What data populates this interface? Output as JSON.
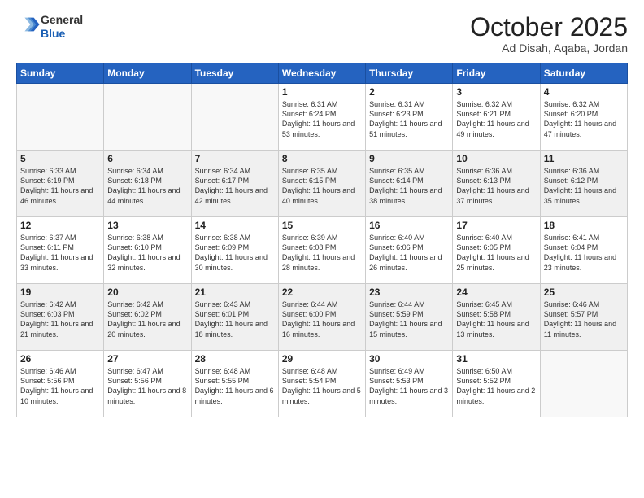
{
  "header": {
    "logo_general": "General",
    "logo_blue": "Blue",
    "month": "October 2025",
    "location": "Ad Disah, Aqaba, Jordan"
  },
  "weekdays": [
    "Sunday",
    "Monday",
    "Tuesday",
    "Wednesday",
    "Thursday",
    "Friday",
    "Saturday"
  ],
  "weeks": [
    [
      {
        "day": "",
        "info": ""
      },
      {
        "day": "",
        "info": ""
      },
      {
        "day": "",
        "info": ""
      },
      {
        "day": "1",
        "info": "Sunrise: 6:31 AM\nSunset: 6:24 PM\nDaylight: 11 hours and 53 minutes."
      },
      {
        "day": "2",
        "info": "Sunrise: 6:31 AM\nSunset: 6:23 PM\nDaylight: 11 hours and 51 minutes."
      },
      {
        "day": "3",
        "info": "Sunrise: 6:32 AM\nSunset: 6:21 PM\nDaylight: 11 hours and 49 minutes."
      },
      {
        "day": "4",
        "info": "Sunrise: 6:32 AM\nSunset: 6:20 PM\nDaylight: 11 hours and 47 minutes."
      }
    ],
    [
      {
        "day": "5",
        "info": "Sunrise: 6:33 AM\nSunset: 6:19 PM\nDaylight: 11 hours and 46 minutes."
      },
      {
        "day": "6",
        "info": "Sunrise: 6:34 AM\nSunset: 6:18 PM\nDaylight: 11 hours and 44 minutes."
      },
      {
        "day": "7",
        "info": "Sunrise: 6:34 AM\nSunset: 6:17 PM\nDaylight: 11 hours and 42 minutes."
      },
      {
        "day": "8",
        "info": "Sunrise: 6:35 AM\nSunset: 6:15 PM\nDaylight: 11 hours and 40 minutes."
      },
      {
        "day": "9",
        "info": "Sunrise: 6:35 AM\nSunset: 6:14 PM\nDaylight: 11 hours and 38 minutes."
      },
      {
        "day": "10",
        "info": "Sunrise: 6:36 AM\nSunset: 6:13 PM\nDaylight: 11 hours and 37 minutes."
      },
      {
        "day": "11",
        "info": "Sunrise: 6:36 AM\nSunset: 6:12 PM\nDaylight: 11 hours and 35 minutes."
      }
    ],
    [
      {
        "day": "12",
        "info": "Sunrise: 6:37 AM\nSunset: 6:11 PM\nDaylight: 11 hours and 33 minutes."
      },
      {
        "day": "13",
        "info": "Sunrise: 6:38 AM\nSunset: 6:10 PM\nDaylight: 11 hours and 32 minutes."
      },
      {
        "day": "14",
        "info": "Sunrise: 6:38 AM\nSunset: 6:09 PM\nDaylight: 11 hours and 30 minutes."
      },
      {
        "day": "15",
        "info": "Sunrise: 6:39 AM\nSunset: 6:08 PM\nDaylight: 11 hours and 28 minutes."
      },
      {
        "day": "16",
        "info": "Sunrise: 6:40 AM\nSunset: 6:06 PM\nDaylight: 11 hours and 26 minutes."
      },
      {
        "day": "17",
        "info": "Sunrise: 6:40 AM\nSunset: 6:05 PM\nDaylight: 11 hours and 25 minutes."
      },
      {
        "day": "18",
        "info": "Sunrise: 6:41 AM\nSunset: 6:04 PM\nDaylight: 11 hours and 23 minutes."
      }
    ],
    [
      {
        "day": "19",
        "info": "Sunrise: 6:42 AM\nSunset: 6:03 PM\nDaylight: 11 hours and 21 minutes."
      },
      {
        "day": "20",
        "info": "Sunrise: 6:42 AM\nSunset: 6:02 PM\nDaylight: 11 hours and 20 minutes."
      },
      {
        "day": "21",
        "info": "Sunrise: 6:43 AM\nSunset: 6:01 PM\nDaylight: 11 hours and 18 minutes."
      },
      {
        "day": "22",
        "info": "Sunrise: 6:44 AM\nSunset: 6:00 PM\nDaylight: 11 hours and 16 minutes."
      },
      {
        "day": "23",
        "info": "Sunrise: 6:44 AM\nSunset: 5:59 PM\nDaylight: 11 hours and 15 minutes."
      },
      {
        "day": "24",
        "info": "Sunrise: 6:45 AM\nSunset: 5:58 PM\nDaylight: 11 hours and 13 minutes."
      },
      {
        "day": "25",
        "info": "Sunrise: 6:46 AM\nSunset: 5:57 PM\nDaylight: 11 hours and 11 minutes."
      }
    ],
    [
      {
        "day": "26",
        "info": "Sunrise: 6:46 AM\nSunset: 5:56 PM\nDaylight: 11 hours and 10 minutes."
      },
      {
        "day": "27",
        "info": "Sunrise: 6:47 AM\nSunset: 5:56 PM\nDaylight: 11 hours and 8 minutes."
      },
      {
        "day": "28",
        "info": "Sunrise: 6:48 AM\nSunset: 5:55 PM\nDaylight: 11 hours and 6 minutes."
      },
      {
        "day": "29",
        "info": "Sunrise: 6:48 AM\nSunset: 5:54 PM\nDaylight: 11 hours and 5 minutes."
      },
      {
        "day": "30",
        "info": "Sunrise: 6:49 AM\nSunset: 5:53 PM\nDaylight: 11 hours and 3 minutes."
      },
      {
        "day": "31",
        "info": "Sunrise: 6:50 AM\nSunset: 5:52 PM\nDaylight: 11 hours and 2 minutes."
      },
      {
        "day": "",
        "info": ""
      }
    ]
  ]
}
